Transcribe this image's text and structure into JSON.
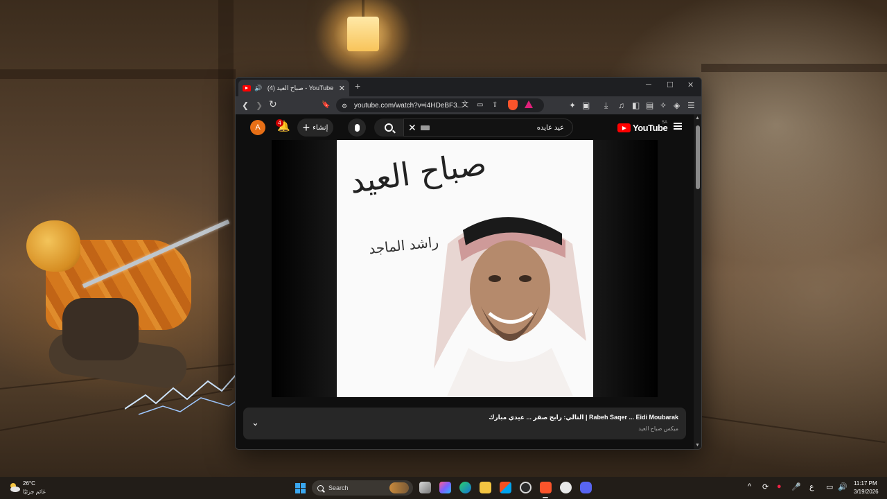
{
  "browser": {
    "tab": {
      "title": "(4) صباح العيد - YouTube",
      "audio_icon": "🔊",
      "close": "✕"
    },
    "new_tab": "+",
    "window_controls": {
      "minimize": "─",
      "maximize": "☐",
      "close": "✕"
    },
    "nav": {
      "back": "❮",
      "forward": "❯",
      "reload": "↻",
      "bookmark": "🔖"
    },
    "address": "youtube.com/watch?v=i4HDeBF3...",
    "accent_color": "#fb542b"
  },
  "youtube": {
    "avatar_letter": "A",
    "notification_count": "4",
    "create_label": "إنشاء",
    "create_plus": "+",
    "search": {
      "value": "عيد عايده",
      "clear": "✕"
    },
    "logo_text": "YouTube",
    "region": "SA",
    "thumbnail": {
      "calligraphy": "صباح العيد",
      "signature": "راشد الماجد"
    },
    "now_playing": {
      "title": "التالي: رابح صقر ... عيدي مبارك | Rabeh Saqer ... Eidi Moubarak",
      "subtitle": "ميكس صباح العيد",
      "chevron": "⌄"
    }
  },
  "taskbar": {
    "weather": {
      "temp": "26°C",
      "desc": "غائم جزئيًا"
    },
    "search_label": "Search",
    "tray": {
      "chevron": "^",
      "lang": "ع"
    },
    "clock": {
      "time": "11:17 PM",
      "date": "3/19/2026"
    }
  }
}
